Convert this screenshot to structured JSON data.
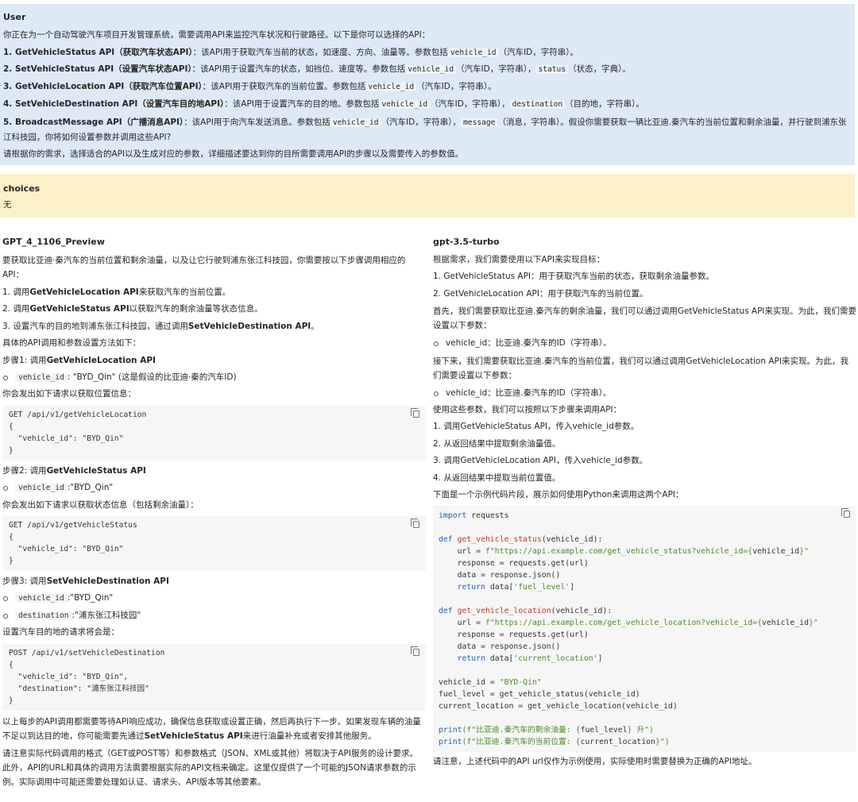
{
  "user": {
    "label": "User",
    "intro": "你正在为一个自动驾驶汽车项目开发管理系统，需要调用API来监控汽车状况和行驶路径。以下是你可以选择的API：",
    "api1": {
      "name": "1. GetVehicleStatus API（获取汽车状态API）",
      "t1": "：该API用于获取汽车当前的状态，如速度、方向、油量等。参数包括",
      "c1": "vehicle_id",
      "t2": "（汽车ID，字符串）。"
    },
    "api2": {
      "name": "2. SetVehicleStatus API（设置汽车状态API）",
      "t1": "：该API用于设置汽车的状态，如挡位、速度等。参数包括",
      "c1": "vehicle_id",
      "t2": "（汽车ID，字符串），",
      "c2": "status",
      "t3": "（状态，字典）。"
    },
    "api3": {
      "name": "3. GetVehicleLocation API（获取汽车位置API）",
      "t1": "：该API用于获取汽车的当前位置。参数包括",
      "c1": "vehicle_id",
      "t2": "（汽车ID，字符串）。"
    },
    "api4": {
      "name": "4. SetVehicleDestination API（设置汽车目的地API）",
      "t1": "：该API用于设置汽车的目的地。参数包括",
      "c1": "vehicle_id",
      "t2": "（汽车ID，字符串），",
      "c2": "destination",
      "t3": "（目的地，字符串）。"
    },
    "api5": {
      "name": "5. BroadcastMessage API（广播消息API）",
      "t1": "：该API用于向汽车发送消息。参数包括",
      "c1": "vehicle_id",
      "t2": "（汽车ID，字符串），",
      "c2": "message",
      "t3": "（消息，字符串）。假设你需要获取一辆比亚迪.秦汽车的当前位置和剩余油量，并行驶到浦东张江科技园，你将如何设置参数并调用这些API?"
    },
    "outro": "请根据你的需求，选择适合的API以及生成对应的参数，详细描述要达到你的目所需要调用API的步骤以及需要传入的参数值。"
  },
  "choices": {
    "label": "choices",
    "value": "无"
  },
  "left": {
    "title": "GPT_4_1106_Preview",
    "p1": "要获取比亚迪·秦汽车的当前位置和剩余油量，以及让它行驶到浦东张江科技园，你需要按以下步骤调用相应的API：",
    "s1a": "1. 调用",
    "s1b": "GetVehicleLocation API",
    "s1c": "来获取汽车的当前位置。",
    "s2a": "2. 调用",
    "s2b": "GetVehicleStatus API",
    "s2c": "以获取汽车的剩余油量等状态信息。",
    "s3a": "3. 设置汽车的目的地到浦东张江科技园，通过调用",
    "s3b": "SetVehicleDestination API",
    "s3c": "。",
    "p2": "具体的API调用和参数设置方法如下：",
    "step1a": "步骤1: 调用",
    "step1b": "GetVehicleLocation API",
    "b1c": "vehicle_id",
    "b1t": ": \"BYD_Qin\" (这是假设的比亚迪·秦的汽车ID)",
    "p3": "你会发出如下请求以获取位置信息：",
    "code1": "GET /api/v1/getVehicleLocation\n{\n  \"vehicle_id\": \"BYD_Qin\"\n}",
    "step2a": "步骤2: 调用",
    "step2b": "GetVehicleStatus API",
    "b2c": "vehicle_id",
    "b2t": ":\"BYD_Qin\"",
    "p4": "你会发出如下请求以获取状态信息（包括剩余油量）：",
    "code2": "GET /api/v1/getVehicleStatus\n{\n  \"vehicle_id\": \"BYD_Qin\"\n}",
    "step3a": "步骤3: 调用",
    "step3b": "SetVehicleDestination API",
    "b3c": "vehicle_id",
    "b3t": ":\"BYD_Qin\"",
    "b4c": "destination",
    "b4t": ":\"浦东张江科技园\"",
    "p5": "设置汽车目的地的请求将会是：",
    "code3": "POST /api/v1/setVehicleDestination\n{\n  \"vehicle_id\": \"BYD_Qin\",\n  \"destination\": \"浦东张江科技园\"\n}",
    "p6a": "以上每步的API调用都需要等待API响应成功，确保信息获取或设置正确，然后再执行下一步。如果发现车辆的油量不足以到达目的地，你可能需要先通过",
    "p6b": "SetVehicleStatus API",
    "p6c": "来进行油量补充或者安排其他服务。",
    "p7": "请注意实际代码调用的格式（GET或POST等）和参数格式（JSON、XML或其他）将取决于API服务的设计要求。此外，API的URL和具体的调用方法需要根据实际的API文档来确定。这里仅提供了一个可能的JSON请求参数的示例。实际调用中可能还需要处理如认证、请求头、API版本等其他要素。"
  },
  "right": {
    "title": "gpt-3.5-turbo",
    "p1": "根据需求，我们需要使用以下API来实现目标：",
    "l1": "1. GetVehicleStatus API：用于获取汽车当前的状态，获取剩余油量参数。",
    "l2": "2. GetVehicleLocation API：用于获取汽车的当前位置。",
    "p2": "首先，我们需要获取比亚迪.秦汽车的剩余油量，我们可以通过调用GetVehicleStatus API来实现。为此，我们需要设置以下参数：",
    "b1": "vehicle_id：比亚迪.秦汽车的ID（字符串）。",
    "p3": "接下来，我们需要获取比亚迪.秦汽车的当前位置，我们可以通过调用GetVehicleLocation API来实现。为此，我们需要设置以下参数：",
    "b2": "vehicle_id：比亚迪.秦汽车的ID（字符串）。",
    "p4": "使用这些参数，我们可以按照以下步骤来调用API：",
    "l3": "1. 调用GetVehicleStatus API，传入vehicle_id参数。",
    "l4": "2. 从返回结果中提取剩余油量值。",
    "l5": "3. 调用GetVehicleLocation API，传入vehicle_id参数。",
    "l6": "4. 从返回结果中提取当前位置值。",
    "p5": "下面是一个示例代码片段，展示如何使用Python来调用这两个API：",
    "code": {
      "k_import": "import",
      "import_rest": " requests",
      "k_def": "def",
      "fn1": "get_vehicle_status",
      "fn1_args": "(vehicle_id):",
      "f1_l1a": "    url = ",
      "f1_l1s": "f\"https://api.example.com/get_vehicle_status?vehicle_id={",
      "f1_l1v": "vehicle_id",
      "f1_l1e": "}\"",
      "f1_l2": "    response = requests.get(url)",
      "f1_l3": "    data = response.json()",
      "k_return": "return",
      "f1_l4a": " data[",
      "f1_l4s": "'fuel_level'",
      "f1_l4e": "]",
      "fn2": "get_vehicle_location",
      "fn2_args": "(vehicle_id):",
      "f2_l1s": "f\"https://api.example.com/get_vehicle_location?vehicle_id={",
      "f2_l1e": "}\"",
      "f2_l4s": "'current_location'",
      "m1a": "vehicle_id = ",
      "m1s": "\"BYD-Qin\"",
      "m2": "fuel_level = get_vehicle_status(vehicle_id)",
      "m3": "current_location = get_vehicle_location(vehicle_id)",
      "k_print": "print",
      "pr1s": "(f\"比亚迪.秦汽车的剩余油量: {",
      "pr1v": "fuel_level",
      "pr1e": "} 升\")",
      "pr2s": "(f\"比亚迪.秦汽车的当前位置: {",
      "pr2v": "current_location",
      "pr2e": "}\")"
    },
    "p6": "请注意，上述代码中的API url仅作为示例使用，实际使用时需要替换为正确的API地址。"
  },
  "colors": {
    "user_bg": "#dde9f5",
    "choices_bg": "#fcf0c9",
    "code_bg": "#f6f6f6",
    "keyword": "#2563b5",
    "function": "#c0392b",
    "string": "#4f8a2d"
  }
}
